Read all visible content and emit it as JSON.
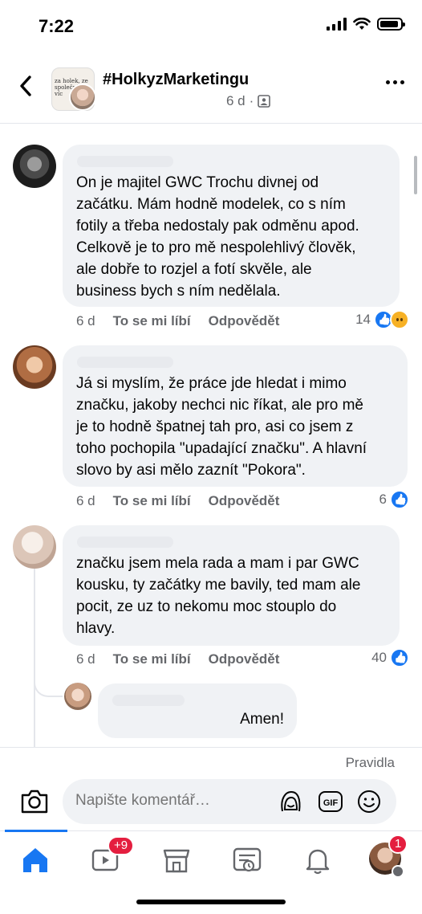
{
  "status_bar": {
    "time": "7:22",
    "battery_level": 0.9
  },
  "header": {
    "group_name": "#HolkyzMarketingu",
    "age": "6 d",
    "separator": "·",
    "avatar_text": "za holek, ze společně me víc"
  },
  "comments": [
    {
      "text_lines": [
        "On je majitel GWC Trochu divnej od",
        "začátku. Mám hodně modelek, co s ním",
        "fotily a třeba nedostaly pak odměnu apod.",
        "Celkově je to pro mě nespolehlivý člověk,",
        "ale dobře to rozjel a fotí skvěle, ale",
        "business bych s ním nedělala."
      ],
      "time": "6 d",
      "like_label": "To se mi líbí",
      "reply_label": "Odpovědět",
      "reaction_count": "14"
    },
    {
      "text_lines": [
        "Já si myslím, že práce jde hledat i mimo",
        "značku, jakoby nechci nic říkat, ale pro mě",
        "je to hodně špatnej tah pro, asi co jsem z",
        "toho pochopila \"upadající značku\". A hlavní",
        "slovo by asi mělo zaznít \"Pokora\"."
      ],
      "time": "6 d",
      "like_label": "To se mi líbí",
      "reply_label": "Odpovědět",
      "reaction_count": "6"
    },
    {
      "text_lines": [
        "značku jsem mela rada a mam i par GWC",
        "kousku, ty začátky me bavily, ted mam ale",
        "pocit, ze uz to nekomu moc stouplo do",
        "hlavy."
      ],
      "time": "6 d",
      "like_label": "To se mi líbí",
      "reply_label": "Odpovědět",
      "reaction_count": "40"
    }
  ],
  "reply": {
    "text": "Amen!"
  },
  "composer": {
    "rules_label": "Pravidla",
    "placeholder": "Napište komentář…"
  },
  "tabbar": {
    "video_badge": "+9",
    "profile_badge": "1"
  },
  "colors": {
    "accent": "#1877f2",
    "bubble": "#f0f2f5",
    "badge": "#e41e3f",
    "secondary_text": "#65676b"
  }
}
